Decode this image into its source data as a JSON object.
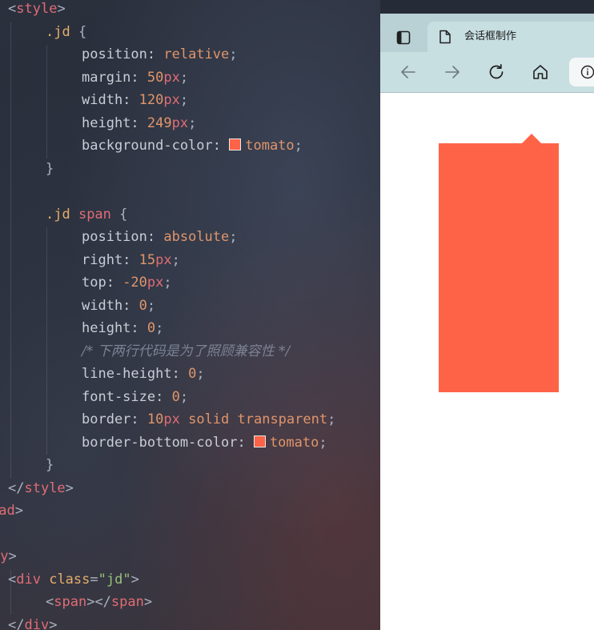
{
  "editor": {
    "lines": [
      [
        {
          "c": "t-punc",
          "t": "<"
        },
        {
          "c": "t-tag",
          "t": "style"
        },
        {
          "c": "t-punc",
          "t": ">"
        }
      ],
      [
        {
          "c": "t-sel",
          "t": ".jd"
        },
        {
          "c": "t-punc",
          "t": " {"
        }
      ],
      [
        {
          "c": "t-prop",
          "t": "position: "
        },
        {
          "c": "t-val",
          "t": "relative"
        },
        {
          "c": "t-punc",
          "t": ";"
        }
      ],
      [
        {
          "c": "t-prop",
          "t": "margin: "
        },
        {
          "c": "t-num",
          "t": "50"
        },
        {
          "c": "t-unit",
          "t": "px"
        },
        {
          "c": "t-punc",
          "t": ";"
        }
      ],
      [
        {
          "c": "t-prop",
          "t": "width: "
        },
        {
          "c": "t-num",
          "t": "120"
        },
        {
          "c": "t-unit",
          "t": "px"
        },
        {
          "c": "t-punc",
          "t": ";"
        }
      ],
      [
        {
          "c": "t-prop",
          "t": "height: "
        },
        {
          "c": "t-num",
          "t": "249"
        },
        {
          "c": "t-unit",
          "t": "px"
        },
        {
          "c": "t-punc",
          "t": ";"
        }
      ],
      [
        {
          "c": "t-prop",
          "t": "background-color: "
        },
        {
          "c": "swatch",
          "t": ""
        },
        {
          "c": "t-val",
          "t": "tomato"
        },
        {
          "c": "t-punc",
          "t": ";"
        }
      ],
      [
        {
          "c": "t-punc",
          "t": "}"
        }
      ],
      [],
      [
        {
          "c": "t-sel",
          "t": ".jd "
        },
        {
          "c": "t-tag",
          "t": "span"
        },
        {
          "c": "t-punc",
          "t": " {"
        }
      ],
      [
        {
          "c": "t-prop",
          "t": "position: "
        },
        {
          "c": "t-val",
          "t": "absolute"
        },
        {
          "c": "t-punc",
          "t": ";"
        }
      ],
      [
        {
          "c": "t-prop",
          "t": "right: "
        },
        {
          "c": "t-num",
          "t": "15"
        },
        {
          "c": "t-unit",
          "t": "px"
        },
        {
          "c": "t-punc",
          "t": ";"
        }
      ],
      [
        {
          "c": "t-prop",
          "t": "top: "
        },
        {
          "c": "t-num",
          "t": "-20"
        },
        {
          "c": "t-unit",
          "t": "px"
        },
        {
          "c": "t-punc",
          "t": ";"
        }
      ],
      [
        {
          "c": "t-prop",
          "t": "width: "
        },
        {
          "c": "t-num",
          "t": "0"
        },
        {
          "c": "t-punc",
          "t": ";"
        }
      ],
      [
        {
          "c": "t-prop",
          "t": "height: "
        },
        {
          "c": "t-num",
          "t": "0"
        },
        {
          "c": "t-punc",
          "t": ";"
        }
      ],
      [
        {
          "c": "t-com",
          "t": "/* 下两行代码是为了照顾兼容性 */"
        }
      ],
      [
        {
          "c": "t-prop",
          "t": "line-height: "
        },
        {
          "c": "t-num",
          "t": "0"
        },
        {
          "c": "t-punc",
          "t": ";"
        }
      ],
      [
        {
          "c": "t-prop",
          "t": "font-size: "
        },
        {
          "c": "t-num",
          "t": "0"
        },
        {
          "c": "t-punc",
          "t": ";"
        }
      ],
      [
        {
          "c": "t-prop",
          "t": "border: "
        },
        {
          "c": "t-num",
          "t": "10"
        },
        {
          "c": "t-unit",
          "t": "px"
        },
        {
          "c": "t-val",
          "t": " solid transparent"
        },
        {
          "c": "t-punc",
          "t": ";"
        }
      ],
      [
        {
          "c": "t-prop",
          "t": "border-bottom-color: "
        },
        {
          "c": "swatch",
          "t": ""
        },
        {
          "c": "t-val",
          "t": "tomato"
        },
        {
          "c": "t-punc",
          "t": ";"
        }
      ],
      [
        {
          "c": "t-punc",
          "t": "}"
        }
      ],
      [
        {
          "c": "t-punc",
          "t": "</"
        },
        {
          "c": "t-tag",
          "t": "style"
        },
        {
          "c": "t-punc",
          "t": ">"
        }
      ],
      [
        {
          "c": "t-tag",
          "t": "ead"
        },
        {
          "c": "t-punc",
          "t": ">"
        }
      ],
      [],
      [
        {
          "c": "t-tag",
          "t": "dy"
        },
        {
          "c": "t-punc",
          "t": ">"
        }
      ],
      [
        {
          "c": "t-punc",
          "t": "<"
        },
        {
          "c": "t-tag",
          "t": "div"
        },
        {
          "c": "t-attr",
          "t": " class"
        },
        {
          "c": "t-punc",
          "t": "="
        },
        {
          "c": "t-str",
          "t": "\"jd\""
        },
        {
          "c": "t-punc",
          "t": ">"
        }
      ],
      [
        {
          "c": "t-punc",
          "t": "<"
        },
        {
          "c": "t-tag",
          "t": "span"
        },
        {
          "c": "t-punc",
          "t": "></"
        },
        {
          "c": "t-tag",
          "t": "span"
        },
        {
          "c": "t-punc",
          "t": ">"
        }
      ],
      [
        {
          "c": "t-punc",
          "t": "</"
        },
        {
          "c": "t-tag",
          "t": "div"
        },
        {
          "c": "t-punc",
          "t": ">"
        }
      ]
    ]
  },
  "browser": {
    "tab": {
      "title": "会话框制作",
      "icon": "page-icon"
    },
    "tab_actions_icon": "tab-actions-icon",
    "toolbar": {
      "back_icon": "back-arrow-icon",
      "forward_icon": "forward-arrow-icon",
      "refresh_icon": "refresh-icon",
      "home_icon": "home-icon",
      "site_info_icon": "info-icon"
    },
    "colors": {
      "chrome": "#c8dfe2",
      "tabstrip": "#b9d0d4",
      "tomato": "#ff6347"
    }
  }
}
